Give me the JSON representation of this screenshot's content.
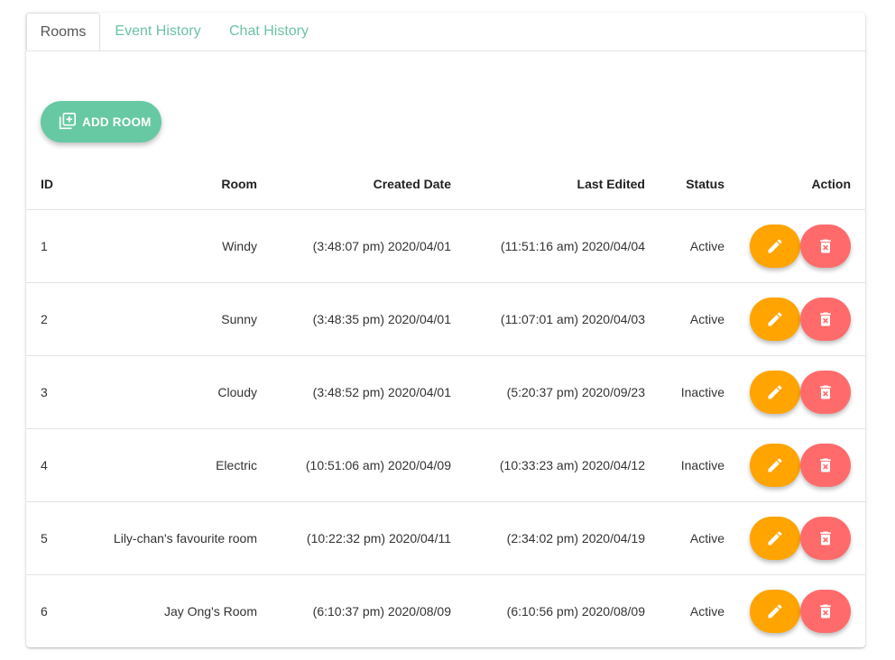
{
  "tabs": [
    {
      "label": "Rooms",
      "active": true
    },
    {
      "label": "Event History",
      "active": false
    },
    {
      "label": "Chat History",
      "active": false
    }
  ],
  "add_button": {
    "label": "ADD ROOM",
    "icon": "add-library-icon"
  },
  "table": {
    "headers": {
      "id": "ID",
      "room": "Room",
      "created": "Created Date",
      "edited": "Last Edited",
      "status": "Status",
      "action": "Action"
    },
    "rows": [
      {
        "id": "1",
        "room": "Windy",
        "created": "(3:48:07 pm) 2020/04/01",
        "edited": "(11:51:16 am) 2020/04/04",
        "status": "Active"
      },
      {
        "id": "2",
        "room": "Sunny",
        "created": "(3:48:35 pm) 2020/04/01",
        "edited": "(11:07:01 am) 2020/04/03",
        "status": "Active"
      },
      {
        "id": "3",
        "room": "Cloudy",
        "created": "(3:48:52 pm) 2020/04/01",
        "edited": "(5:20:37 pm) 2020/09/23",
        "status": "Inactive"
      },
      {
        "id": "4",
        "room": "Electric",
        "created": "(10:51:06 am) 2020/04/09",
        "edited": "(10:33:23 am) 2020/04/12",
        "status": "Inactive"
      },
      {
        "id": "5",
        "room": "Lily-chan's favourite room",
        "created": "(10:22:32 pm) 2020/04/11",
        "edited": "(2:34:02 pm) 2020/04/19",
        "status": "Active"
      },
      {
        "id": "6",
        "room": "Jay Ong's Room",
        "created": "(6:10:37 pm) 2020/08/09",
        "edited": "(6:10:56 pm) 2020/08/09",
        "status": "Active"
      }
    ]
  },
  "row_actions": {
    "edit_icon": "pencil-icon",
    "delete_icon": "trash-x-icon"
  },
  "colors": {
    "accent": "#66c9a4",
    "edit": "#ffa400",
    "delete": "#ff6b6b",
    "tab_inactive": "#6cc3a2"
  }
}
